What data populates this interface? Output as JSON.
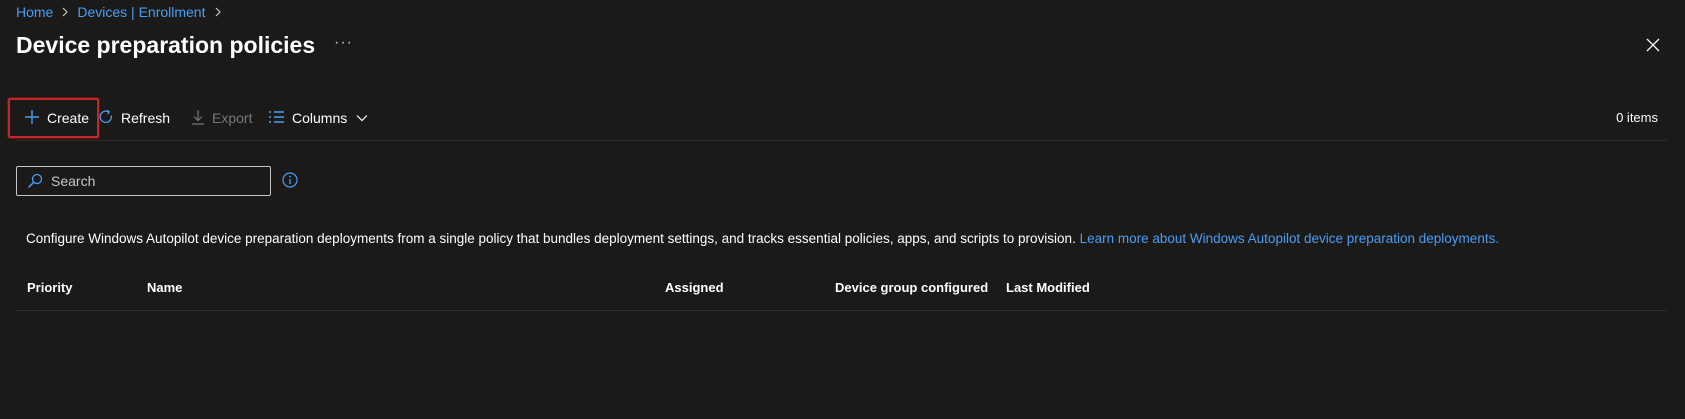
{
  "breadcrumb": {
    "items": [
      "Home",
      "Devices | Enrollment"
    ]
  },
  "page": {
    "title": "Device preparation policies",
    "more_label": "···"
  },
  "toolbar": {
    "create_label": "Create",
    "refresh_label": "Refresh",
    "export_label": "Export",
    "columns_label": "Columns",
    "items_count": "0 items"
  },
  "search": {
    "placeholder": "Search",
    "value": ""
  },
  "description": {
    "text": "Configure Windows Autopilot device preparation deployments from a single policy that bundles deployment settings, and tracks essential policies, apps, and scripts to provision. ",
    "link": "Learn more about Windows Autopilot device preparation deployments."
  },
  "table": {
    "columns": [
      "Priority",
      "Name",
      "Assigned",
      "Device group configured",
      "Last Modified"
    ],
    "rows": []
  },
  "icons": [
    "chevron-right-icon",
    "more-icon",
    "close-icon",
    "plus-icon",
    "refresh-icon",
    "download-icon",
    "columns-list-icon",
    "chevron-down-icon",
    "search-icon",
    "info-icon"
  ],
  "colors": {
    "background": "#1b1a19",
    "link": "#479ef5",
    "highlight_border": "#c4262e",
    "disabled_text": "#797775",
    "divider": "#2f2e2d"
  }
}
